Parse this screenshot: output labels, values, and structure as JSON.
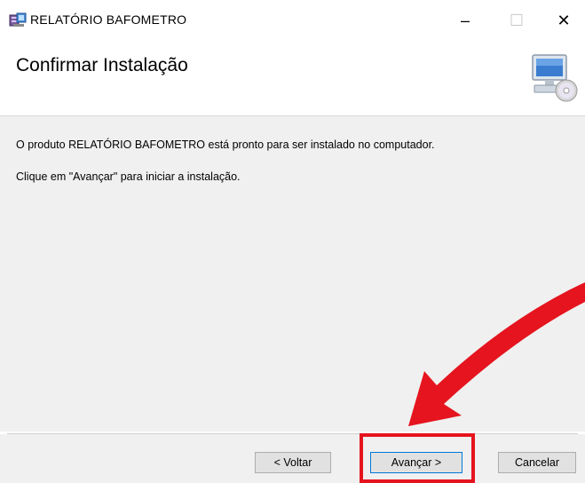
{
  "window": {
    "title": "RELATÓRIO BAFOMETRO",
    "minimize_symbol": "–",
    "maximize_symbol": "☐",
    "close_symbol": "✕"
  },
  "header": {
    "title": "Confirmar Instalação",
    "icon": "computer-cd-icon"
  },
  "content": {
    "line1": "O produto RELATÓRIO BAFOMETRO está pronto para ser instalado no computador.",
    "line2": "Clique em \"Avançar\" para iniciar a instalação."
  },
  "buttons": {
    "back": "< Voltar",
    "next": "Avançar >",
    "cancel": "Cancelar"
  },
  "annotation": {
    "color": "#e5141e",
    "arrow": "red-curved-arrow",
    "highlight": "red-box-around-next-button"
  }
}
